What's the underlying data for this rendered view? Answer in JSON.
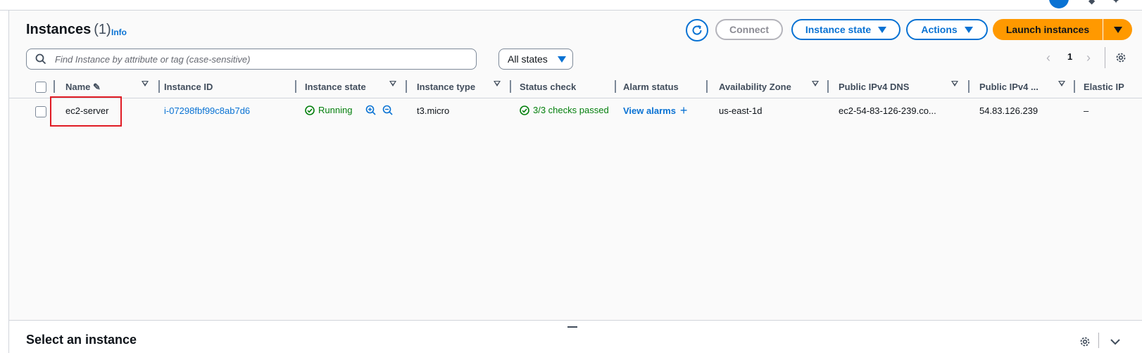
{
  "header": {
    "title": "Instances",
    "count": "(1)",
    "info_label": "Info"
  },
  "toolbar": {
    "connect_label": "Connect",
    "instance_state_label": "Instance state",
    "actions_label": "Actions",
    "launch_label": "Launch instances"
  },
  "search": {
    "placeholder": "Find Instance by attribute or tag (case-sensitive)"
  },
  "filter": {
    "states_label": "All states"
  },
  "pagination": {
    "current_page": "1"
  },
  "table": {
    "columns": [
      "Name",
      "Instance ID",
      "Instance state",
      "Instance type",
      "Status check",
      "Alarm status",
      "Availability Zone",
      "Public IPv4 DNS",
      "Public IPv4 ...",
      "Elastic IP"
    ],
    "rows": [
      {
        "name": "ec2-server",
        "instance_id": "i-07298fbf99c8ab7d6",
        "instance_state": "Running",
        "instance_type": "t3.micro",
        "status_check": "3/3 checks passed",
        "alarm_status": "View alarms",
        "availability_zone": "us-east-1d",
        "public_dns": "ec2-54-83-126-239.co...",
        "public_ipv4": "54.83.126.239",
        "elastic_ip": "–"
      }
    ]
  },
  "details": {
    "title": "Select an instance"
  },
  "colors": {
    "accent": "#0972d3",
    "launch": "#ff9900",
    "success": "#037f0c",
    "highlight": "#e01b24"
  }
}
